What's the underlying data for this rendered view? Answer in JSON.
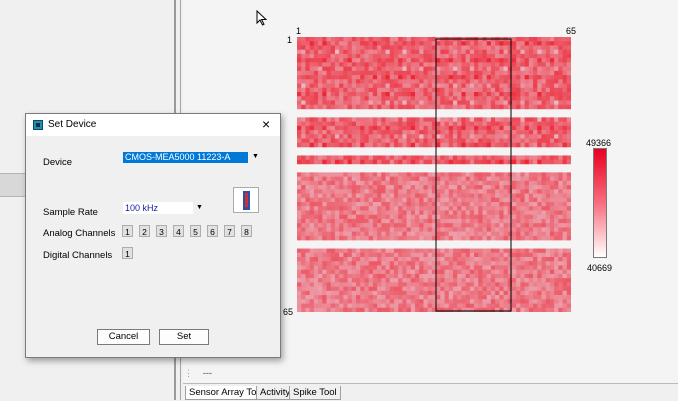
{
  "heatmap": {
    "x_start": "1",
    "x_end": "65",
    "y_start": "1",
    "y_end": "65",
    "colorbar_max": "49366",
    "colorbar_min": "40669",
    "colors": {
      "high": "#e8001f",
      "low": "#ffffff"
    }
  },
  "dialog": {
    "title": "Set Device",
    "close": "×",
    "device_label": "Device",
    "device_value": "CMOS-MEA5000 11223-A",
    "sample_rate_label": "Sample Rate",
    "sample_rate_value": "100 kHz",
    "analog_label": "Analog Channels",
    "analog_channels": [
      "1",
      "2",
      "3",
      "4",
      "5",
      "6",
      "7",
      "8"
    ],
    "digital_label": "Digital Channels",
    "digital_channels": [
      "1"
    ],
    "cancel_label": "Cancel",
    "set_label": "Set"
  },
  "status": {
    "placeholder": "---"
  },
  "tabs": [
    "Sensor Array Tool",
    "Activity",
    "Spike Tool"
  ]
}
